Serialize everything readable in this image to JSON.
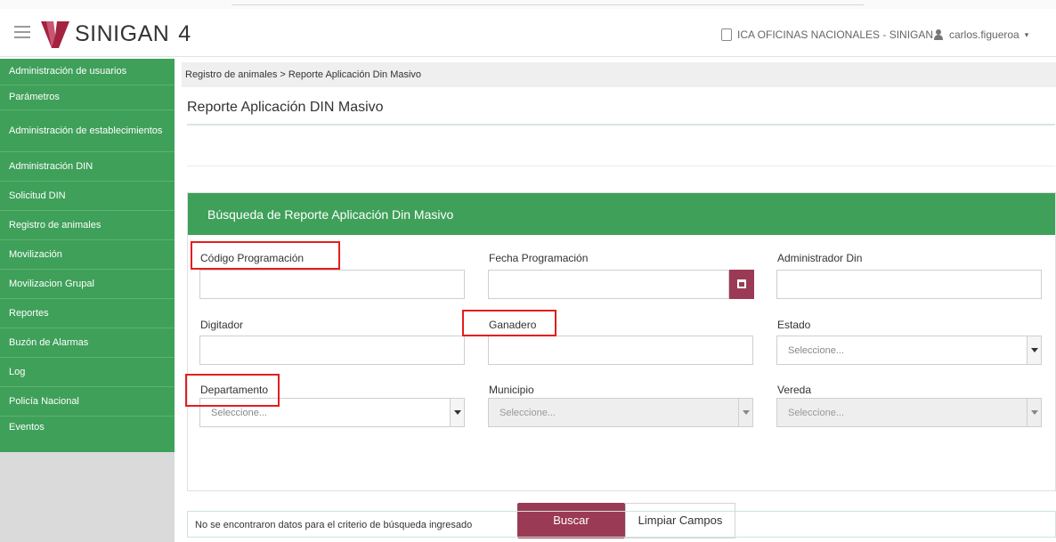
{
  "header": {
    "brand": "SINIGAN",
    "version": "4",
    "office": "ICA OFICINAS NACIONALES - SINIGAN",
    "user": "carlos.figueroa"
  },
  "sidebar": {
    "items": [
      {
        "label": "Administración de usuarios"
      },
      {
        "label": "Parámetros"
      },
      {
        "label": "Administración de establecimientos"
      },
      {
        "label": "Administración DIN"
      },
      {
        "label": "Solicitud DIN"
      },
      {
        "label": "Registro de animales"
      },
      {
        "label": "Movilización"
      },
      {
        "label": "Movilizacion Grupal"
      },
      {
        "label": "Reportes"
      },
      {
        "label": "Buzón de Alarmas"
      },
      {
        "label": "Log"
      },
      {
        "label": "Policía Nacional"
      },
      {
        "label": "Eventos"
      }
    ]
  },
  "breadcrumb": "Registro de animales > Reporte Aplicación Din Masivo",
  "page_title": "Reporte Aplicación DIN Masivo",
  "panel": {
    "title": "Búsqueda de Reporte Aplicación Din Masivo",
    "fields": {
      "codigo": {
        "label": "Código Programación",
        "value": ""
      },
      "fecha": {
        "label": "Fecha Programación",
        "value": ""
      },
      "administrador": {
        "label": "Administrador Din",
        "value": ""
      },
      "digitador": {
        "label": "Digitador",
        "value": ""
      },
      "ganadero": {
        "label": "Ganadero",
        "value": ""
      },
      "estado": {
        "label": "Estado",
        "value": "Seleccione..."
      },
      "departamento": {
        "label": "Departamento",
        "value": "Seleccione..."
      },
      "municipio": {
        "label": "Municipio",
        "value": "Seleccione..."
      },
      "vereda": {
        "label": "Vereda",
        "value": "Seleccione..."
      }
    },
    "buttons": {
      "search": "Buscar",
      "clear": "Limpiar Campos"
    }
  },
  "result_message": "No se encontraron datos para el criterio de búsqueda ingresado",
  "colors": {
    "green": "#3fa05a",
    "maroon": "#9b3a55",
    "highlight_red": "#e51d1d"
  },
  "icons": [
    "menu-icon",
    "sinigan-logo",
    "phone-icon",
    "user-icon",
    "calendar-icon",
    "caret-down-icon"
  ]
}
